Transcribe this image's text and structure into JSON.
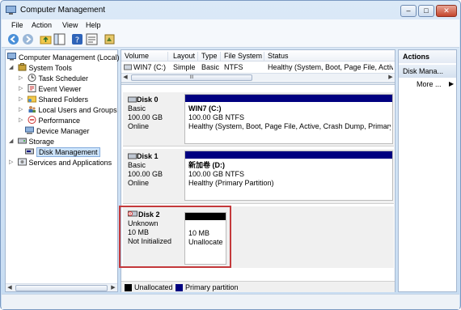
{
  "window": {
    "title": "Computer Management"
  },
  "menu": [
    "File",
    "Action",
    "View",
    "Help"
  ],
  "tree": {
    "root": "Computer Management (Local)",
    "items": [
      {
        "label": "System Tools",
        "level": 1
      },
      {
        "label": "Task Scheduler",
        "level": 2
      },
      {
        "label": "Event Viewer",
        "level": 2
      },
      {
        "label": "Shared Folders",
        "level": 2
      },
      {
        "label": "Local Users and Groups",
        "level": 2
      },
      {
        "label": "Performance",
        "level": 2
      },
      {
        "label": "Device Manager",
        "level": 2
      },
      {
        "label": "Storage",
        "level": 1
      },
      {
        "label": "Disk Management",
        "level": 2
      },
      {
        "label": "Services and Applications",
        "level": 1
      }
    ]
  },
  "volume_list": {
    "columns": [
      "Volume",
      "Layout",
      "Type",
      "File System",
      "Status"
    ],
    "rows": [
      {
        "volume": "WIN7 (C:)",
        "layout": "Simple",
        "type": "Basic",
        "fs": "NTFS",
        "status": "Healthy (System, Boot, Page File, Activ"
      }
    ],
    "scroll_marker": "III"
  },
  "disks": [
    {
      "name": "Disk 0",
      "type": "Basic",
      "size": "100.00 GB",
      "state": "Online",
      "partition": {
        "title": "WIN7 (C:)",
        "size": "100.00 GB NTFS",
        "status": "Healthy (System, Boot, Page File, Active, Crash Dump, Primary Pa"
      }
    },
    {
      "name": "Disk 1",
      "type": "Basic",
      "size": "100.00 GB",
      "state": "Online",
      "partition": {
        "title": "新加卷 (D:)",
        "size": "100.00 GB NTFS",
        "status": "Healthy (Primary Partition)"
      }
    },
    {
      "name": "Disk 2",
      "type": "Unknown",
      "size": "10 MB",
      "state": "Not Initialized",
      "partition": {
        "title": "",
        "size": "10 MB",
        "status": "Unallocate"
      }
    }
  ],
  "legend": [
    {
      "label": "Unallocated",
      "color": "#000000"
    },
    {
      "label": "Primary partition",
      "color": "#000080"
    }
  ],
  "actions": {
    "title": "Actions",
    "section": "Disk Mana...",
    "more": "More ..."
  },
  "colors": {
    "primary_partition": "#000080",
    "unallocated": "#000000",
    "highlight": "#c4393b"
  }
}
